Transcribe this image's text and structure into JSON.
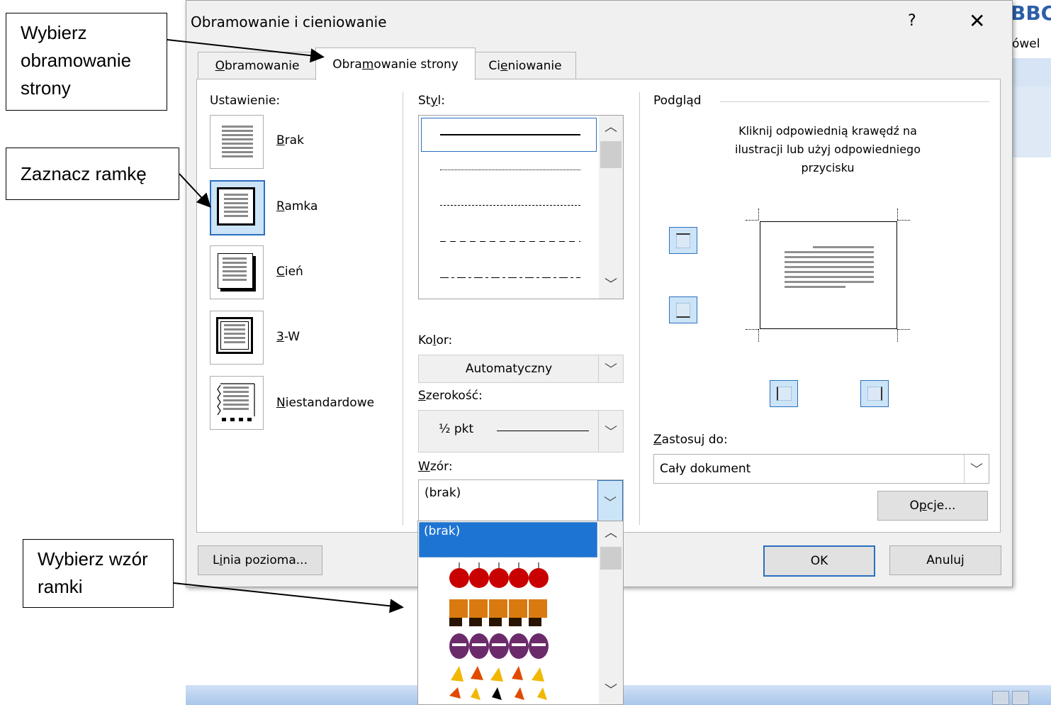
{
  "background": {
    "fragment_top": "ВВС",
    "fragment_mid": "ówel"
  },
  "dialog": {
    "title": "Obramowanie i cieniowanie",
    "help": "?",
    "close": "✕",
    "tabs": [
      {
        "pre": "",
        "u": "O",
        "post": "bramowanie"
      },
      {
        "pre": "Obra",
        "u": "m",
        "post": "owanie strony"
      },
      {
        "pre": "Ci",
        "u": "e",
        "post": "niowanie"
      }
    ],
    "active_tab_index": 1
  },
  "setting": {
    "label": "Ustawienie:",
    "items": [
      {
        "u": "B",
        "rest": "rak"
      },
      {
        "u": "R",
        "rest": "amka"
      },
      {
        "u": "C",
        "rest": "ień"
      },
      {
        "u": "3",
        "rest": "-W"
      },
      {
        "u": "N",
        "rest": "iestandardowe"
      }
    ],
    "selected_index": 1
  },
  "style": {
    "label_pre": "St",
    "label_u": "y",
    "label_post": "l:",
    "options": [
      "solid",
      "dotted",
      "dashed-fine",
      "dashed",
      "dash-dot"
    ],
    "selected_index": 0
  },
  "color": {
    "label_pre": "Ko",
    "label_u": "l",
    "label_post": "or:",
    "value": "Automatyczny"
  },
  "width": {
    "label_pre": "",
    "label_u": "S",
    "label_post": "zerokość:",
    "value": "½ pkt"
  },
  "art": {
    "label_pre": "",
    "label_u": "W",
    "label_post": "zór:",
    "value": "(brak)",
    "dropdown_selected": "(brak)"
  },
  "preview": {
    "label": "Podgląd",
    "hint": "Kliknij odpowiednią krawędź na ilustracji lub użyj odpowiedniego przycisku"
  },
  "apply_to": {
    "label_pre": "",
    "label_u": "Z",
    "label_post": "astosuj do:",
    "value": "Cały dokument"
  },
  "buttons": {
    "options_pre": "O",
    "options_u": "p",
    "options_post": "cje...",
    "horizontal_pre": "L",
    "horizontal_u": "i",
    "horizontal_post": "nia pozioma...",
    "ok": "OK",
    "cancel": "Anuluj"
  },
  "callouts": {
    "page_border": "Wybierz obramowanie strony",
    "select_box": "Zaznacz ramkę",
    "choose_art": "Wybierz wzór ramki"
  },
  "colors": {
    "accent": "#2a6fbf",
    "selection": "#1e74d2",
    "selected_fill": "#cce4f7"
  }
}
